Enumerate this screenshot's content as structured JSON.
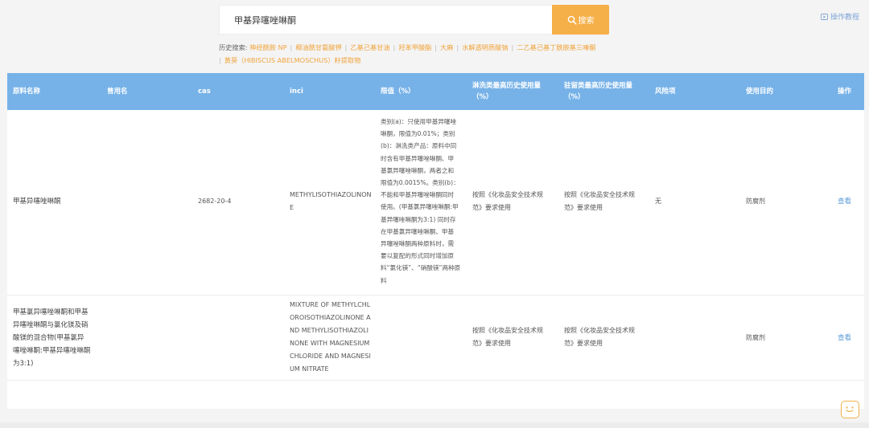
{
  "search": {
    "query": "甲基异噻唑啉酮",
    "button_label": "搜索"
  },
  "tutorial_label": "操作教程",
  "history": {
    "label": "历史搜索:",
    "items": [
      "神经酰胺 NP",
      "椰油酰甘氨酸钾",
      "乙基己基甘油",
      "羟苯甲酸酯",
      "大麻",
      "水解透明质酸钠",
      "二乙基己基丁酰胺基三嗪酮",
      "黄葵（HIBISCUS ABELMOSCHUS）籽提取物"
    ]
  },
  "table": {
    "headers": {
      "raw_name": "原料名称",
      "common_name": "曾用名",
      "cas": "cas",
      "inci": "inci",
      "limit": "限值（%）",
      "rinse_off_line1": "淋洗类最高历史使用量",
      "rinse_off_line2": "（%）",
      "leave_on_line1": "驻留类最高历史使用量",
      "leave_on_line2": "（%）",
      "risk": "风险项",
      "purpose": "使用目的",
      "action": "操作"
    },
    "rows": [
      {
        "raw_name": [
          "甲基异噻唑啉酮"
        ],
        "common_name": "",
        "cas": "2682-20-4",
        "inci": [
          "METHYLISOTHIAZOLINON",
          "E"
        ],
        "limit": [
          "类别(a)：只使用甲基异噻唑",
          "啉酮，限值为0.01%；类别",
          "(b)：淋洗类产品：原料中同",
          "时含有甲基异噻唑啉酮、甲",
          "基氯异噻唑啉酮，两者之和",
          "限值为0.0015%。类别(b)：",
          "不能和甲基异噻唑啉酮同时",
          "使用。(甲基氯异噻唑啉酮:甲",
          "基异噻唑啉酮为3:1) 同时存",
          "在甲基氯异噻唑啉酮、甲基",
          "异噻唑啉酮两种原料时，需",
          "要以复配的形式同时增加原",
          "料“氯化镁”、“硝酸镁”两种原",
          "料"
        ],
        "rinse_off": [
          "按照《化妆品安全技术规",
          "范》要求使用"
        ],
        "leave_on": [
          "按照《化妆品安全技术规",
          "范》要求使用"
        ],
        "risk": "无",
        "purpose": "防腐剂",
        "action": "查看"
      },
      {
        "raw_name": [
          "甲基氯异噻唑啉酮和甲基",
          "异噻唑啉酮与氯化镁及硝",
          "酸镁的混合物(甲基氯异",
          "噻唑啉酮:甲基异噻唑啉酮",
          "为3:1)"
        ],
        "common_name": "",
        "cas": "",
        "inci": [
          "MIXTURE OF METHYLCHL",
          "OROISOTHIAZOLINONE A",
          "ND METHYLISOTHIAZOLI",
          "NONE WITH MAGNESIUM",
          "CHLORIDE AND MAGNESI",
          "UM NITRATE"
        ],
        "limit": [],
        "rinse_off": [
          "按照《化妆品安全技术规",
          "范》要求使用"
        ],
        "leave_on": [
          "按照《化妆品安全技术规",
          "范》要求使用"
        ],
        "risk": "",
        "purpose": "防腐剂",
        "action": "查看"
      }
    ]
  },
  "colors": {
    "accent": "#f6b049",
    "header_bg": "#76b2e8",
    "link": "#5b9ad9",
    "history_link": "#f0a43c"
  },
  "icons": [
    "search-icon",
    "video-play-icon",
    "chat-face-icon"
  ]
}
